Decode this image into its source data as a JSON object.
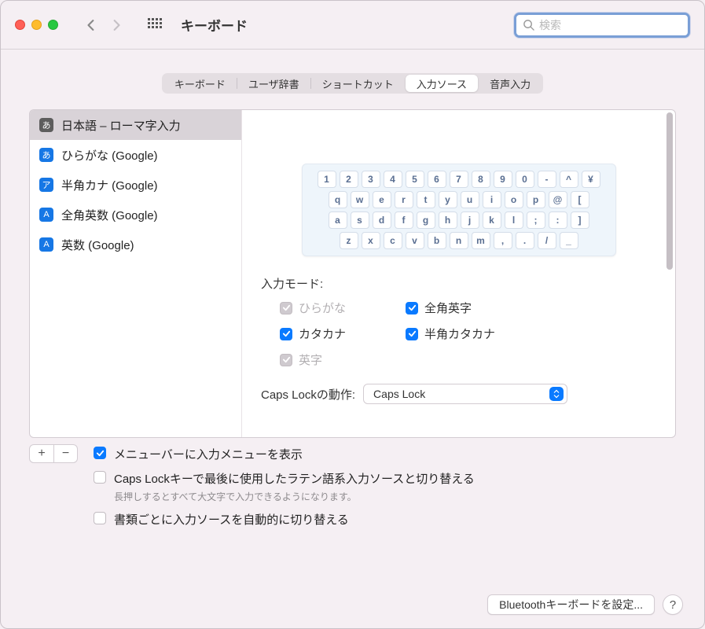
{
  "toolbar": {
    "title": "キーボード",
    "search_placeholder": "検索"
  },
  "tabs": {
    "items": [
      "キーボード",
      "ユーザ辞書",
      "ショートカット",
      "入力ソース",
      "音声入力"
    ],
    "active_index": 3
  },
  "sources": [
    {
      "label": "日本語 – ローマ字入力",
      "badge_text": "あ",
      "badge_color": "gray",
      "selected": true
    },
    {
      "label": "ひらがな (Google)",
      "badge_text": "あ",
      "badge_color": "blue",
      "selected": false
    },
    {
      "label": "半角カナ (Google)",
      "badge_text": "ア",
      "badge_color": "blue",
      "selected": false
    },
    {
      "label": "全角英数 (Google)",
      "badge_text": "A",
      "badge_color": "blue",
      "selected": false
    },
    {
      "label": "英数 (Google)",
      "badge_text": "A",
      "badge_color": "blue",
      "selected": false
    }
  ],
  "keyboard_preview": {
    "rows": [
      [
        "1",
        "2",
        "3",
        "4",
        "5",
        "6",
        "7",
        "8",
        "9",
        "0",
        "-",
        "^",
        "¥"
      ],
      [
        "q",
        "w",
        "e",
        "r",
        "t",
        "y",
        "u",
        "i",
        "o",
        "p",
        "@",
        "["
      ],
      [
        "a",
        "s",
        "d",
        "f",
        "g",
        "h",
        "j",
        "k",
        "l",
        ";",
        ":",
        "]"
      ],
      [
        "z",
        "x",
        "c",
        "v",
        "b",
        "n",
        "m",
        ",",
        ".",
        "/",
        "_"
      ]
    ]
  },
  "input_mode": {
    "label": "入力モード:",
    "items": [
      {
        "text": "ひらがな",
        "checked": true,
        "disabled": true
      },
      {
        "text": "全角英字",
        "checked": true,
        "disabled": false
      },
      {
        "text": "カタカナ",
        "checked": true,
        "disabled": false
      },
      {
        "text": "半角カタカナ",
        "checked": true,
        "disabled": false
      },
      {
        "text": "英字",
        "checked": true,
        "disabled": true
      }
    ]
  },
  "caps_lock": {
    "label": "Caps Lockの動作:",
    "value": "Caps Lock"
  },
  "footer": {
    "options": [
      {
        "text": "メニューバーに入力メニューを表示",
        "checked": true
      },
      {
        "text": "Caps Lockキーで最後に使用したラテン語系入力ソースと切り替える",
        "checked": false,
        "sub": "長押しするとすべて大文字で入力できるようになります。"
      },
      {
        "text": "書類ごとに入力ソースを自動的に切り替える",
        "checked": false
      }
    ],
    "bluetooth_button": "Bluetoothキーボードを設定..."
  },
  "icons": {
    "plus": "+",
    "minus": "−",
    "help": "?"
  }
}
